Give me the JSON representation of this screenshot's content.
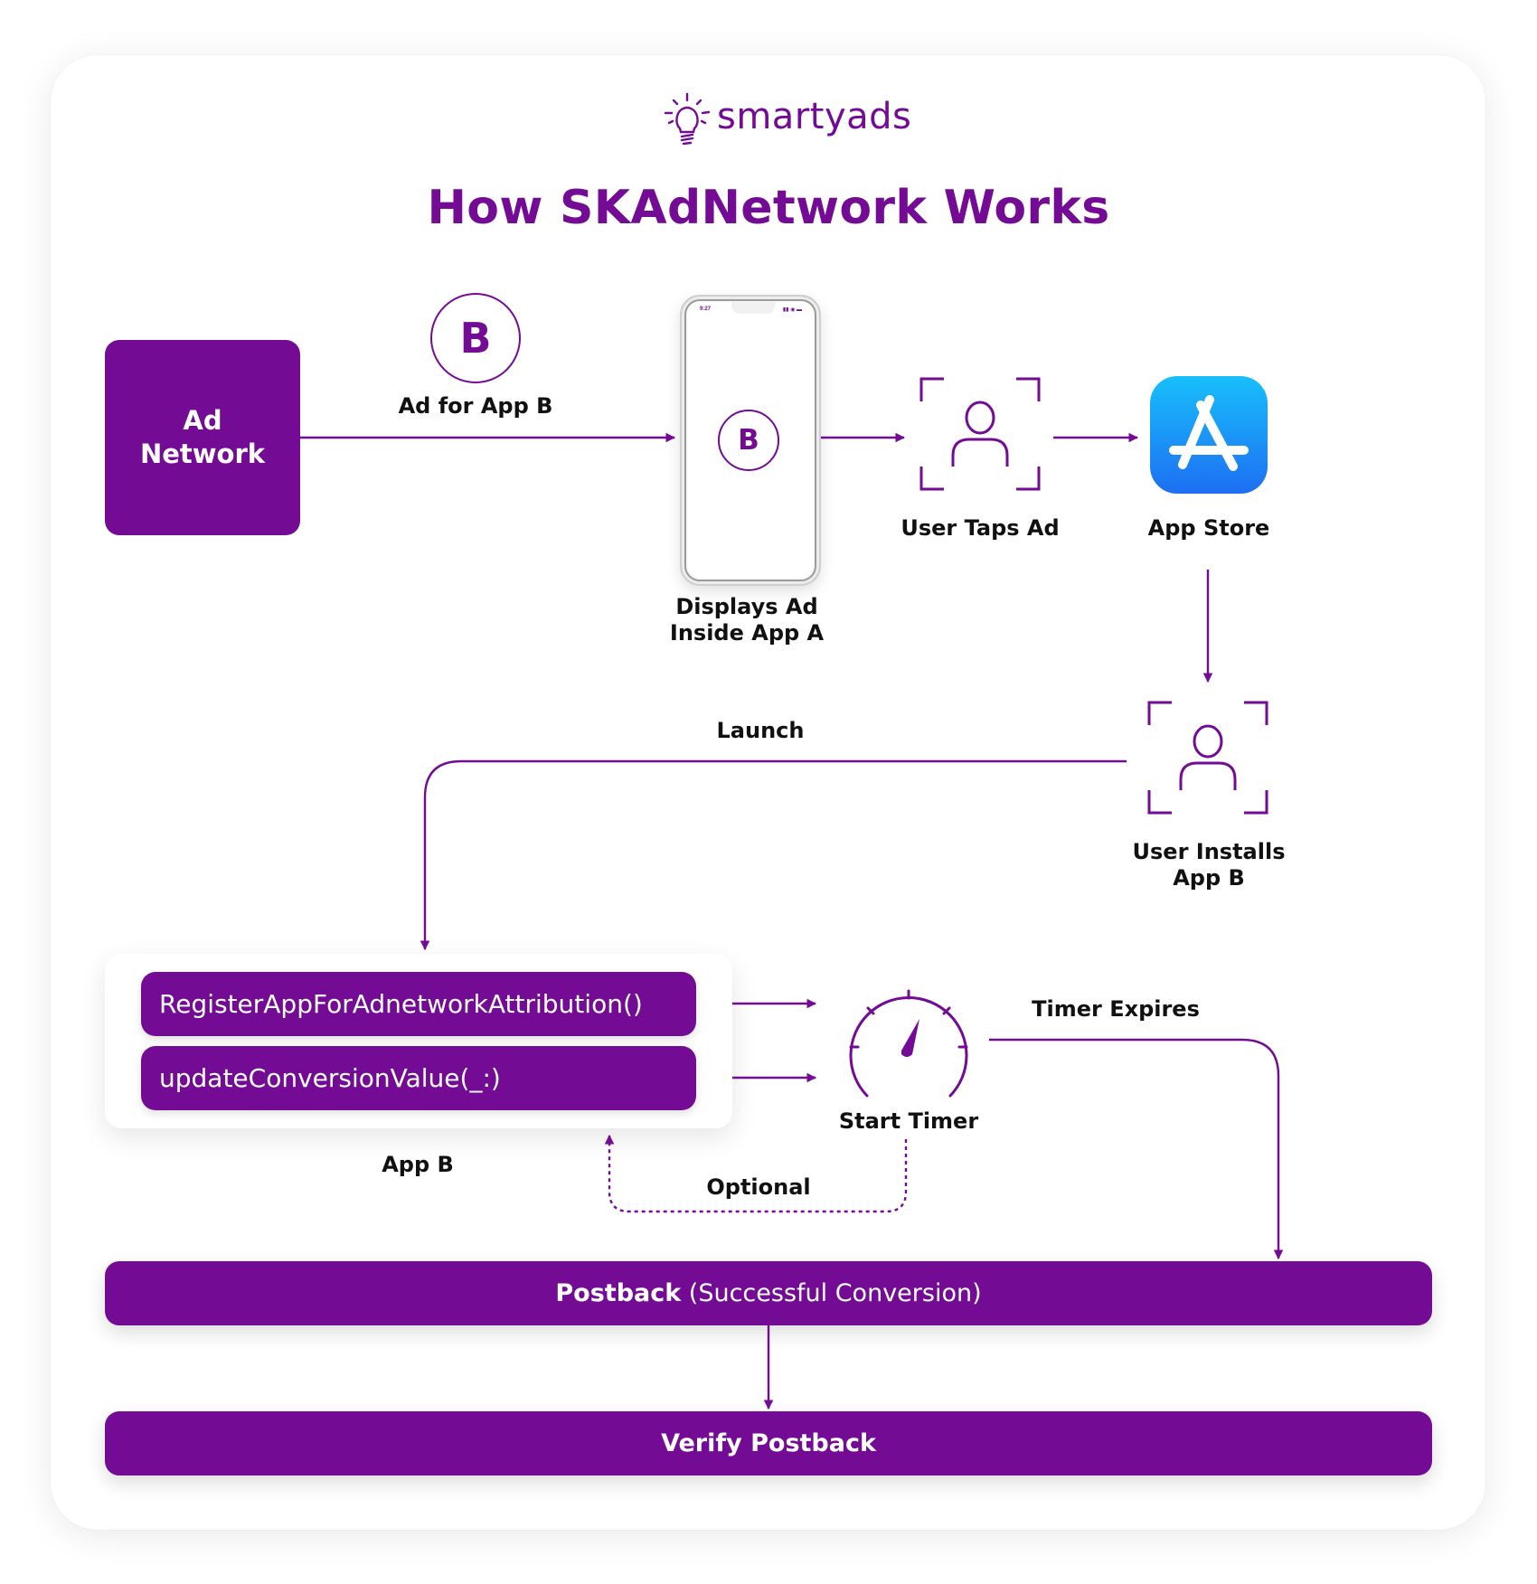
{
  "brand": {
    "logo_text": "smartyads",
    "logo_icon": "lightbulb-icon",
    "accent_color": "#730b95",
    "appstore_gradient": [
      "#18bffb",
      "#1d6ff2"
    ]
  },
  "title": "How SKAdNetwork Works",
  "nodes": {
    "ad_network": {
      "line1": "Ad",
      "line2": "Network"
    },
    "ad_for_app_b": {
      "badge": "B",
      "label": "Ad for App B"
    },
    "phone": {
      "badge": "B",
      "time": "9:27",
      "label_line1": "Displays Ad",
      "label_line2": "Inside App A"
    },
    "user_taps_ad": {
      "label": "User Taps Ad",
      "icon": "user-scan-icon"
    },
    "app_store": {
      "label": "App Store",
      "icon": "app-store-icon"
    },
    "user_installs": {
      "label_line1": "User Installs",
      "label_line2": "App B",
      "icon": "user-scan-icon"
    },
    "launch": {
      "label": "Launch"
    },
    "app_b": {
      "label": "App B",
      "methods": [
        "RegisterAppForAdnetworkAttribution()",
        "updateConversionValue(_:)"
      ]
    },
    "start_timer": {
      "label": "Start Timer",
      "icon": "gauge-icon"
    },
    "timer_expires": {
      "label": "Timer Expires"
    },
    "optional": {
      "label": "Optional"
    },
    "postback": {
      "bold": "Postback",
      "rest": " (Successful Conversion)"
    },
    "verify": {
      "label": "Verify Postback"
    }
  }
}
